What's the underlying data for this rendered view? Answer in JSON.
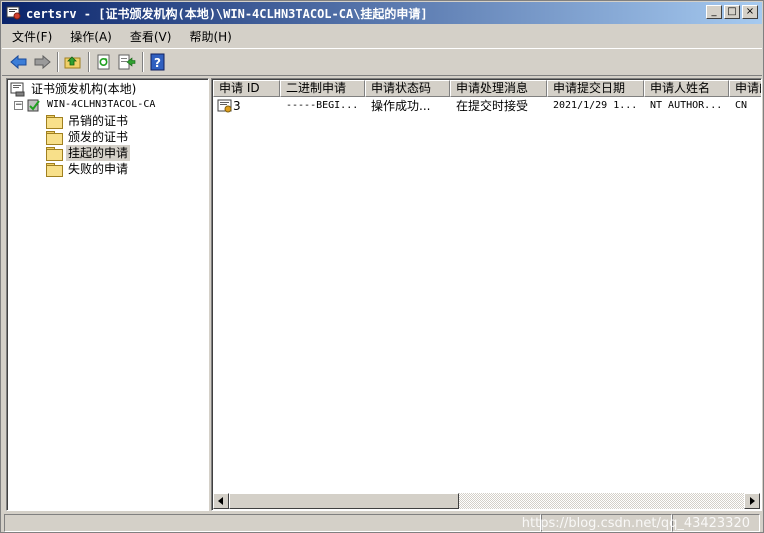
{
  "window": {
    "title": "certsrv - [证书颁发机构(本地)\\WIN-4CLHN3TACOL-CA\\挂起的申请]",
    "icon": "cert-app-icon",
    "buttons": {
      "minimize": "_",
      "maximize": "□",
      "close": "×"
    }
  },
  "menu": [
    {
      "label": "文件(F)"
    },
    {
      "label": "操作(A)"
    },
    {
      "label": "查看(V)"
    },
    {
      "label": "帮助(H)"
    }
  ],
  "toolbar": {
    "buttons": [
      "back-icon",
      "forward-icon",
      "up-folder-icon",
      "refresh-icon",
      "export-icon",
      "help-icon"
    ]
  },
  "tree": {
    "root": "证书颁发机构(本地)",
    "ca": "WIN-4CLHN3TACOL-CA",
    "ca_expander": "−",
    "folders": [
      "吊销的证书",
      "颁发的证书",
      "挂起的申请",
      "失败的申请"
    ],
    "selected": "挂起的申请"
  },
  "list": {
    "columns": [
      "申请 ID",
      "二进制申请",
      "申请状态码",
      "申请处理消息",
      "申请提交日期",
      "申请人姓名",
      "申请的"
    ],
    "rows": [
      {
        "id": "3",
        "binary": "-----BEGI...",
        "status": "操作成功...",
        "message": "在提交时接受",
        "date": "2021/1/29 1...",
        "requester": "NT AUTHOR...",
        "cn": "CN"
      }
    ]
  },
  "status": {
    "watermark": "https://blog.csdn.net/qq_43423320"
  },
  "colors": {
    "titlebar_start": "#0a246a",
    "titlebar_end": "#a6caf0",
    "chrome": "#d4d0c8"
  }
}
